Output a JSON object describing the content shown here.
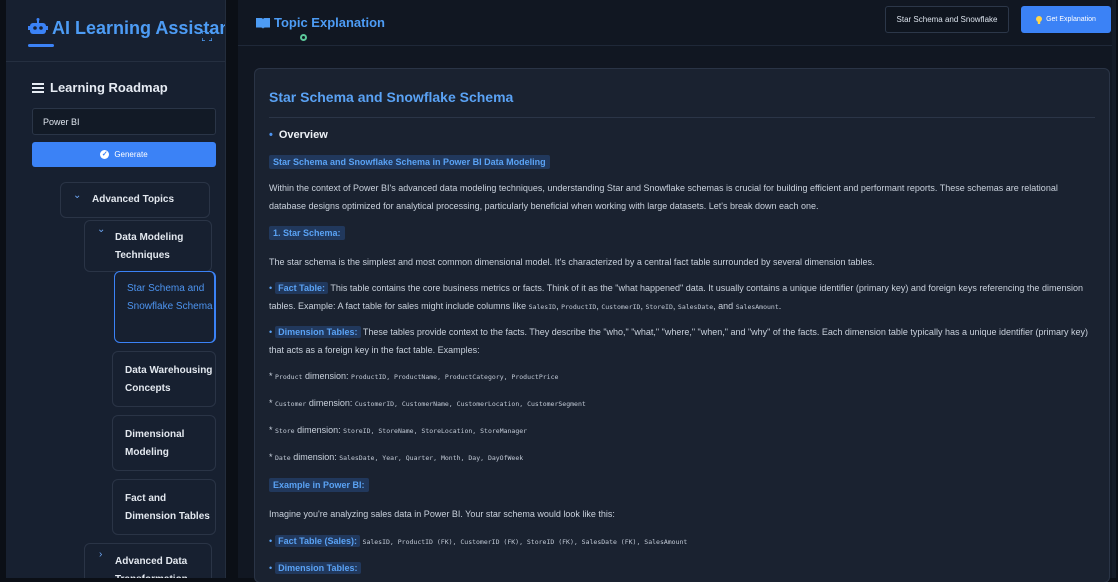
{
  "app": {
    "title": "AI Learning Assistant"
  },
  "sidebar": {
    "roadmap_title": "Learning Roadmap",
    "topic_input_value": "Power BI",
    "generate_label": "Generate",
    "tree": [
      {
        "label": "Advanced Topics",
        "level": 0,
        "expanded": true
      },
      {
        "label": "Data Modeling Techniques",
        "level": 1,
        "expanded": true
      },
      {
        "label": "Star Schema and Snowflake Schema",
        "level": 2,
        "active": true
      },
      {
        "label": "Data Warehousing Concepts",
        "level": 2
      },
      {
        "label": "Dimensional Modeling",
        "level": 2
      },
      {
        "label": "Fact and Dimension Tables",
        "level": 2
      },
      {
        "label": "Advanced Data Transformation",
        "level": 1
      }
    ]
  },
  "main": {
    "title": "Topic Explanation",
    "topic_chip": "Star Schema and Snowflake",
    "explain_label": "Get Explanation",
    "card_title": "Star Schema and Snowflake Schema",
    "overview": "Overview",
    "subheading": "Star Schema and Snowflake Schema in Power BI Data Modeling",
    "intro": "Within the context of Power BI's advanced data modeling techniques, understanding Star and Snowflake schemas is crucial for building efficient and performant reports. These schemas are relational database designs optimized for analytical processing, particularly beneficial when working with large datasets. Let's break down each one.",
    "section1": "1. Star Schema:",
    "star_desc": "The star schema is the simplest and most common dimensional model. It's characterized by a central fact table surrounded by several dimension tables.",
    "fact_tag": "Fact Table:",
    "fact_text": "This table contains the core business metrics or facts. Think of it as the \"what happened\" data. It usually contains a unique identifier (primary key) and foreign keys referencing the dimension tables. Example: A fact table for sales might include columns like",
    "fact_cols": [
      "SalesID",
      "ProductID",
      "CustomerID",
      "StoreID",
      "SalesDate"
    ],
    "fact_and": "and",
    "fact_last": "SalesAmount",
    "dim_tag": "Dimension Tables:",
    "dim_text": "These tables provide context to the facts. They describe the \"who,\" \"what,\" \"where,\" \"when,\" and \"why\" of the facts. Each dimension table typically has a unique identifier (primary key) that acts as a foreign key in the fact table. Examples:",
    "dimensions": [
      {
        "name": "Product",
        "word": "dimension:",
        "cols": "ProductID, ProductName, ProductCategory, ProductPrice"
      },
      {
        "name": "Customer",
        "word": "dimension:",
        "cols": "CustomerID, CustomerName, CustomerLocation, CustomerSegment"
      },
      {
        "name": "Store",
        "word": "dimension:",
        "cols": "StoreID, StoreName, StoreLocation, StoreManager"
      },
      {
        "name": "Date",
        "word": "dimension:",
        "cols": "SalesDate, Year, Quarter, Month, Day, DayOfWeek"
      }
    ],
    "example_heading": "Example in Power BI:",
    "example_text": "Imagine you're analyzing sales data in Power BI. Your star schema would look like this:",
    "fact_sales_tag": "Fact Table (Sales):",
    "fact_sales_cols": "SalesID, ProductID (FK), CustomerID (FK), StoreID (FK), SalesDate (FK), SalesAmount",
    "dim_tables_tag": "Dimension Tables:"
  }
}
